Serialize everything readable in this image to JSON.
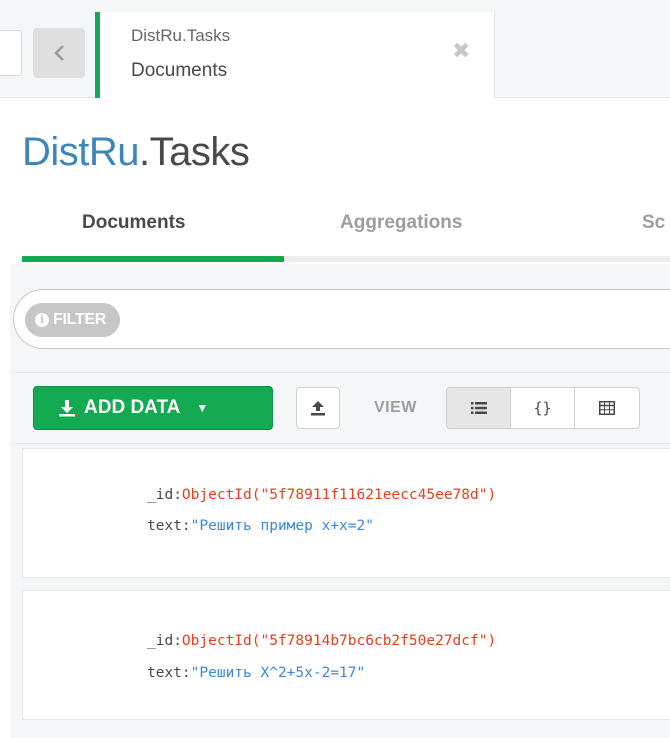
{
  "tab": {
    "db_coll": "DistRu.Tasks",
    "subtitle": "Documents",
    "close_glyph": "✖"
  },
  "title": {
    "db": "DistRu",
    "coll": ".Tasks"
  },
  "subtabs": [
    {
      "label": "Documents"
    },
    {
      "label": "Aggregations"
    },
    {
      "label": "Sc"
    }
  ],
  "filter": {
    "pill_label": "FILTER",
    "info_glyph": "i"
  },
  "toolbar": {
    "add_data_label": "ADD DATA",
    "caret": "▼",
    "view_label": "VIEW",
    "view_json_glyph": "{}"
  },
  "documents": [
    {
      "id_key": "_id:",
      "id_value": "ObjectId(\"5f78911f11621eecc45ee78d\")",
      "text_key": "text:",
      "text_value": "\"Решить пример x+x=2\""
    },
    {
      "id_key": "_id:",
      "id_value": "ObjectId(\"5f78914b7bc6cb2f50e27dcf\")",
      "text_key": "text:",
      "text_value": "\"Решить X^2+5x-2=17\""
    }
  ],
  "colors": {
    "accent_green": "#13aa52",
    "db_blue": "#3d87b8",
    "oid_red": "#e2401f",
    "string_blue": "#3e87d6"
  }
}
